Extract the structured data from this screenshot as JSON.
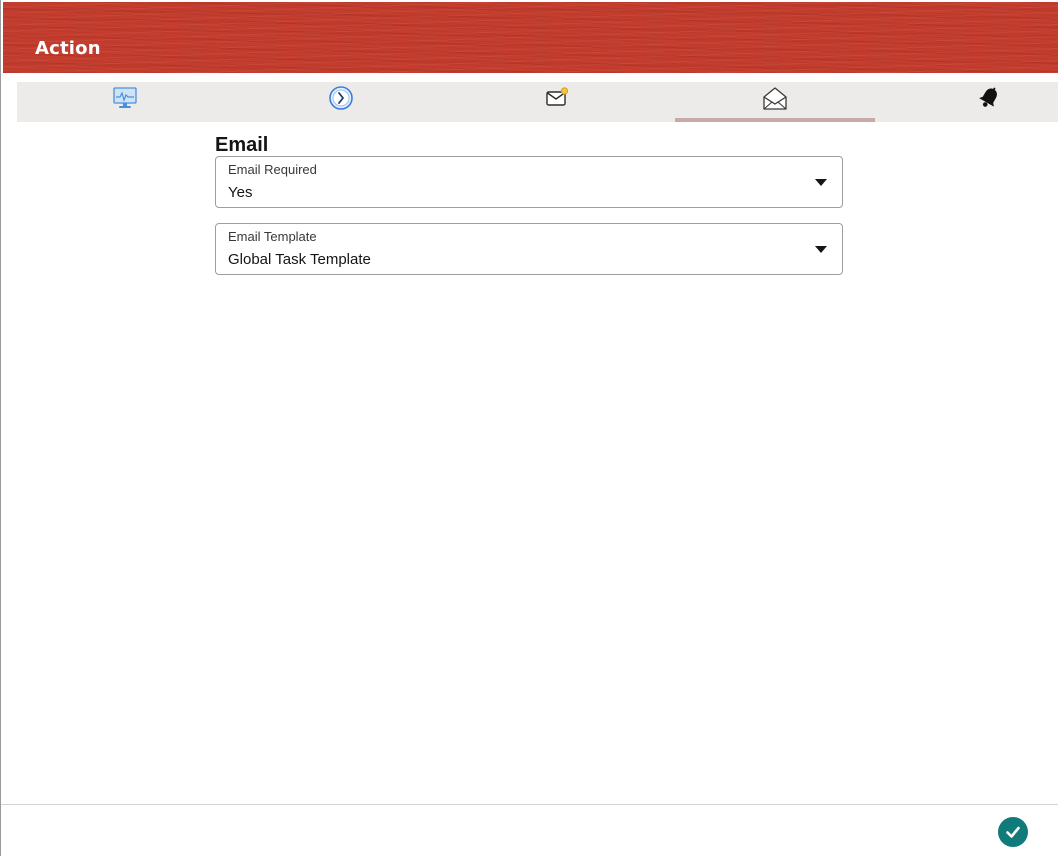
{
  "dialog": {
    "title": "Action"
  },
  "tabs": [
    {
      "icon": "monitor-icon",
      "active": false
    },
    {
      "icon": "clock-icon",
      "active": false
    },
    {
      "icon": "new-mail-icon",
      "active": false
    },
    {
      "icon": "open-envelope-icon",
      "active": true
    },
    {
      "icon": "bell-icon",
      "active": false
    }
  ],
  "email": {
    "section_title": "Email",
    "email_required": {
      "label": "Email Required",
      "value": "Yes"
    },
    "email_template": {
      "label": "Email Template",
      "value": "Global Task Template"
    }
  },
  "footer": {
    "confirm_icon": "checkmark-icon"
  },
  "colors": {
    "header": "#c53d2e",
    "tabbar": "#edebe9",
    "active_tab_indicator": "#c9a9a6",
    "confirm_button": "#117b7b"
  }
}
